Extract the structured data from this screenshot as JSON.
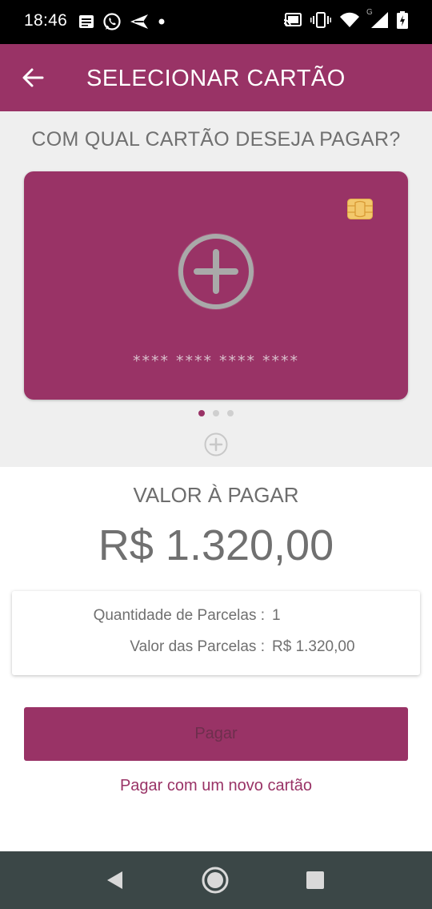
{
  "status_bar": {
    "time": "18:46",
    "left_icons": [
      "news-icon",
      "whatsapp-icon",
      "send-icon",
      "dot-icon"
    ],
    "right_icons": [
      "cast-icon",
      "vibrate-icon",
      "wifi-icon",
      "signal-icon",
      "battery-icon"
    ],
    "network_label": "G"
  },
  "app_bar": {
    "title": "SELECIONAR CARTÃO",
    "back_icon": "arrow-left-icon"
  },
  "card_section": {
    "question": "COM QUAL CARTÃO DESEJA PAGAR?",
    "card_number": "**** **** **** ****",
    "page_count": 3,
    "active_page": 1
  },
  "payment": {
    "amount_label": "VALOR À PAGAR",
    "amount_value": "R$ 1.320,00",
    "installments_label": "Quantidade de Parcelas :",
    "installments_value": "1",
    "installment_amount_label": "Valor das Parcelas :",
    "installment_amount_value": "R$ 1.320,00"
  },
  "actions": {
    "pay_label": "Pagar",
    "new_card_label": "Pagar com um novo cartão"
  },
  "colors": {
    "primary": "#993366",
    "background_gray": "#efefef",
    "text_gray": "#707070",
    "nav_bar": "#3b4747"
  }
}
